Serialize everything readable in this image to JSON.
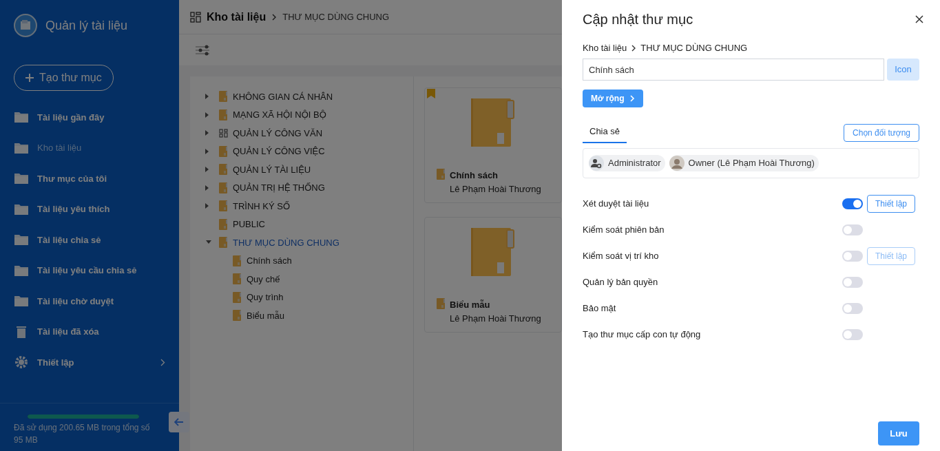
{
  "app": {
    "title": "Quản lý tài liệu"
  },
  "create_button": "Tạo thư mục",
  "sidebar": {
    "items": [
      {
        "label": "Tài liệu gần đây",
        "kind": "folder",
        "selected": false
      },
      {
        "label": "Kho tài liệu",
        "kind": "folder",
        "selected": true
      },
      {
        "label": "Thư mục của tôi",
        "kind": "folder",
        "selected": false
      },
      {
        "label": "Tài liệu yêu thích",
        "kind": "folder",
        "selected": false
      },
      {
        "label": "Tài liệu chia sẻ",
        "kind": "folder",
        "selected": false
      },
      {
        "label": "Tài liệu yêu cầu chia sẻ",
        "kind": "folder",
        "selected": false
      },
      {
        "label": "Tài liệu chờ duyệt",
        "kind": "folder",
        "selected": false
      },
      {
        "label": "Tài liệu đã xóa",
        "kind": "trash",
        "selected": false
      },
      {
        "label": "Thiết lập",
        "kind": "settings",
        "selected": false,
        "submenu": true
      }
    ]
  },
  "storage": {
    "text": "Đã sử dụng 200.65 MB trong tổng số 95 MB",
    "level": 1
  },
  "breadcrumb": {
    "root": "Kho tài liệu",
    "current": "THƯ MỤC DÙNG CHUNG"
  },
  "tree": [
    {
      "label": "KHÔNG GIAN CÁ NHÂN",
      "kind": "folder",
      "expanded": false,
      "selected": false
    },
    {
      "label": "MẠNG XÃ HỘI NỘI BỘ",
      "kind": "folder",
      "expanded": false,
      "selected": false
    },
    {
      "label": "QUẢN LÝ CÔNG VĂN",
      "kind": "module",
      "expanded": false,
      "selected": false
    },
    {
      "label": "QUẢN LÝ CÔNG VIỆC",
      "kind": "folder",
      "expanded": false,
      "selected": false
    },
    {
      "label": "QUẢN LÝ TÀI LIỆU",
      "kind": "folder",
      "expanded": false,
      "selected": false
    },
    {
      "label": "QUẢN TRỊ HỆ THỐNG",
      "kind": "folder",
      "expanded": false,
      "selected": false
    },
    {
      "label": "TRÌNH KÝ SỐ",
      "kind": "folder",
      "expanded": false,
      "selected": false
    },
    {
      "label": "PUBLIC",
      "kind": "folder",
      "selected": false
    },
    {
      "label": "THƯ MỤC DÙNG CHUNG",
      "kind": "folder",
      "expanded": true,
      "selected": true,
      "children": [
        {
          "label": "Chính sách",
          "kind": "folder",
          "selected": false
        },
        {
          "label": "Quy chế",
          "kind": "folder",
          "selected": false
        },
        {
          "label": "Quy trình",
          "kind": "folder",
          "selected": false
        },
        {
          "label": "Biểu mẫu",
          "kind": "folder",
          "selected": false
        }
      ]
    }
  ],
  "cards": [
    {
      "title": "Chính sách",
      "owner": "Lê Phạm Hoài Thương",
      "bookmarked": true
    },
    {
      "title": "Biểu mẫu",
      "owner": "Lê Phạm Hoài Thương",
      "bookmarked": false
    }
  ],
  "dialog": {
    "title": "Cập nhật thư mục",
    "breadcrumb": {
      "root": "Kho tài liệu",
      "current": "THƯ MỤC DÙNG CHUNG"
    },
    "name_value": "Chính sách",
    "icon_button": "Icon",
    "expand_button": "Mở rộng",
    "tabs": [
      {
        "label": "Chia sẻ",
        "selected": true
      }
    ],
    "choose_button": "Chọn đối tượng",
    "shared_with": [
      {
        "label": "Administrator",
        "kind": "group"
      },
      {
        "label": "Owner (Lê Phạm Hoài Thương)",
        "kind": "person"
      }
    ],
    "settings": [
      {
        "label": "Xét duyệt tài liệu",
        "on": true,
        "button": {
          "label": "Thiết lập",
          "disabled": false
        }
      },
      {
        "label": "Kiểm soát phiên bản",
        "on": false
      },
      {
        "label": "Kiểm soát vị trí kho",
        "on": false,
        "button": {
          "label": "Thiết lập",
          "disabled": true
        }
      },
      {
        "label": "Quản lý bản quyền",
        "on": false
      },
      {
        "label": "Bảo mật",
        "on": false
      },
      {
        "label": "Tạo thư mục cấp con tự động",
        "on": false
      }
    ],
    "save_button": "Lưu"
  }
}
